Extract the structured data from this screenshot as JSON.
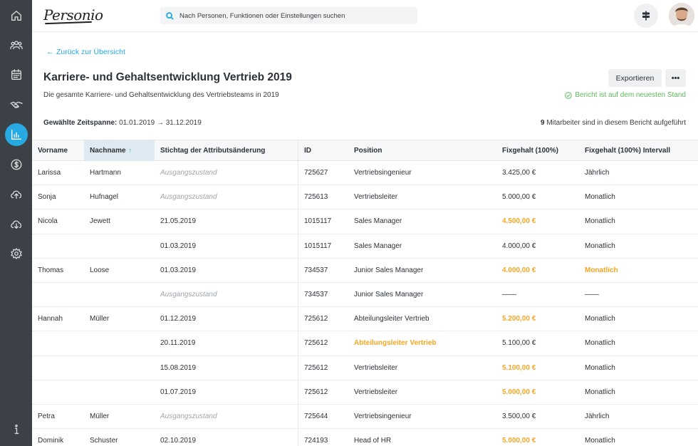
{
  "header": {
    "logo_text": "Personio",
    "search_placeholder": "Nach Personen, Funktionen oder Einstellungen suchen"
  },
  "sidebar": {
    "items": [
      {
        "icon": "home-icon"
      },
      {
        "icon": "people-icon"
      },
      {
        "icon": "calendar-icon"
      },
      {
        "icon": "handshake-icon"
      },
      {
        "icon": "reports-icon",
        "active": true
      },
      {
        "icon": "payroll-icon"
      },
      {
        "icon": "upload-icon"
      },
      {
        "icon": "download-icon"
      },
      {
        "icon": "settings-icon"
      },
      {
        "icon": "info-icon"
      }
    ]
  },
  "page": {
    "back_link": "Zurück zur Übersicht",
    "title": "Karriere- und Gehaltsentwicklung Vertrieb 2019",
    "subtitle": "Die gesamte Karriere- und Gehaltsentwicklung des Vertriebsteams in 2019",
    "export_label": "Exportieren",
    "more_label": "•••",
    "status_text": "Bericht ist auf dem neuesten Stand",
    "period_label": "Gewählte Zeitspanne:",
    "period_value": "01.01.2019 → 31.12.2019",
    "count_number": "9",
    "count_text": "Mitarbeiter sind in diesem Bericht aufgeführt"
  },
  "colors": {
    "accent": "#27a9e1",
    "highlight": "#f5a623",
    "success": "#5cb85c",
    "sidebar": "#3b4147"
  },
  "table": {
    "columns": [
      "Vorname",
      "Nachname",
      "Stichtag der Attributsänderung",
      "ID",
      "Position",
      "Fixgehalt (100%)",
      "Fixgehalt (100%) Intervall"
    ],
    "sorted_column": "Nachname",
    "rows": [
      {
        "vorname": "Larissa",
        "nachname": "Hartmann",
        "stichtag": "Ausgangszustand",
        "id": "725627",
        "position": "Vertriebsingenieur",
        "gehalt": "3.425,00 €",
        "intervall": "Jährlich"
      },
      {
        "vorname": "Sonja",
        "nachname": "Hufnagel",
        "stichtag": "Ausgangszustand",
        "id": "725613",
        "position": "Vertriebsleiter",
        "gehalt": "5.000,00 €",
        "intervall": "Monatlich"
      },
      {
        "vorname": "Nicola",
        "nachname": "Jewett",
        "stichtag": "21.05.2019",
        "id": "1015117",
        "position": "Sales Manager",
        "gehalt": "4.500,00 €",
        "intervall": "Monatlich",
        "hl_gehalt": true
      },
      {
        "vorname": "",
        "nachname": "",
        "stichtag": "01.03.2019",
        "id": "1015117",
        "position": "Sales Manager",
        "gehalt": "4.000,00 €",
        "intervall": "Monatlich"
      },
      {
        "vorname": "Thomas",
        "nachname": "Loose",
        "stichtag": "01.03.2019",
        "id": "734537",
        "position": "Junior Sales Manager",
        "gehalt": "4.000,00 €",
        "intervall": "Monatlich",
        "hl_gehalt": true,
        "hl_intervall": true
      },
      {
        "vorname": "",
        "nachname": "",
        "stichtag": "Ausgangszustand",
        "id": "734537",
        "position": "Junior Sales Manager",
        "gehalt": "——",
        "intervall": "——"
      },
      {
        "vorname": "Hannah",
        "nachname": "Müller",
        "stichtag": "01.12.2019",
        "id": "725612",
        "position": "Abteilungsleiter Vertrieb",
        "gehalt": "5.200,00 €",
        "intervall": "Monatlich",
        "hl_gehalt": true
      },
      {
        "vorname": "",
        "nachname": "",
        "stichtag": "20.11.2019",
        "id": "725612",
        "position": "Abteilungsleiter Vertrieb",
        "gehalt": "5.100,00 €",
        "intervall": "Monatlich",
        "hl_position": true
      },
      {
        "vorname": "",
        "nachname": "",
        "stichtag": "15.08.2019",
        "id": "725612",
        "position": "Vertriebsleiter",
        "gehalt": "5.100,00 €",
        "intervall": "Monatlich",
        "hl_gehalt": true
      },
      {
        "vorname": "",
        "nachname": "",
        "stichtag": "01.07.2019",
        "id": "725612",
        "position": "Vertriebsleiter",
        "gehalt": "5.000,00 €",
        "intervall": "Monatlich",
        "hl_gehalt": true
      },
      {
        "vorname": "Petra",
        "nachname": "Müller",
        "stichtag": "Ausgangszustand",
        "id": "725644",
        "position": "Vertriebsingenieur",
        "gehalt": "3.500,00 €",
        "intervall": "Jährlich"
      },
      {
        "vorname": "Dominik",
        "nachname": "Schuster",
        "stichtag": "02.10.2019",
        "id": "724193",
        "position": "Head of HR",
        "gehalt": "5.000,00 €",
        "intervall": "Monatlich",
        "hl_gehalt": true
      }
    ]
  }
}
